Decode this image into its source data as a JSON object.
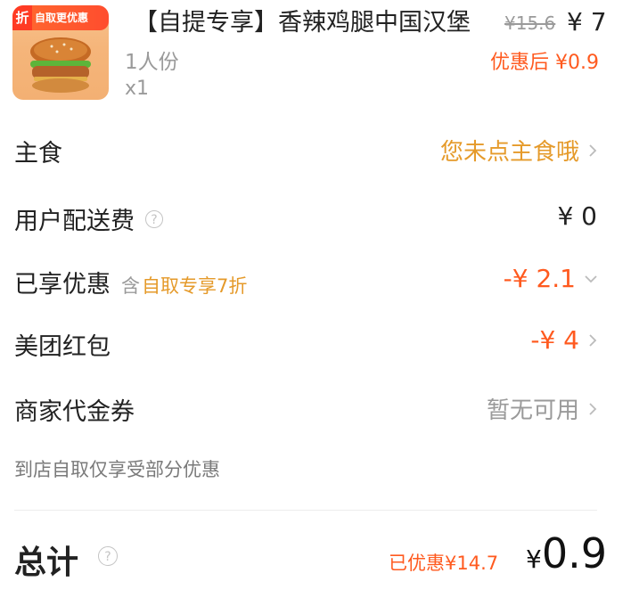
{
  "product": {
    "promo_badge": "折",
    "promo_text": "自取更优惠",
    "title": "【自提专享】香辣鸡腿中国汉堡",
    "original_price": "¥15.6",
    "price": "¥ 7",
    "serving": "1人份",
    "quantity": "x1",
    "after_discount": "优惠后 ¥0.9"
  },
  "rows": {
    "staple": {
      "label": "主食",
      "value": "您未点主食哦"
    },
    "delivery": {
      "label": "用户配送费",
      "value": "¥ 0"
    },
    "discount": {
      "label": "已享优惠",
      "prefix": "含",
      "detail": "自取专享7折",
      "value": "-¥ 2.1"
    },
    "redpacket": {
      "label": "美团红包",
      "value": "-¥ 4"
    },
    "voucher": {
      "label": "商家代金券",
      "value": "暂无可用"
    }
  },
  "note": "到店自取仅享受部分优惠",
  "total": {
    "label": "总计",
    "saved": "已优惠¥14.7",
    "yen": "¥",
    "amount": "0.9"
  },
  "colors": {
    "accent_orange": "#ff5a1f",
    "warn_gold": "#e59a2a",
    "muted": "#9a9a9a"
  },
  "icons": {
    "chevron": "chevron-right-icon",
    "chevron_down": "chevron-down-icon",
    "help": "question-circle-icon"
  }
}
